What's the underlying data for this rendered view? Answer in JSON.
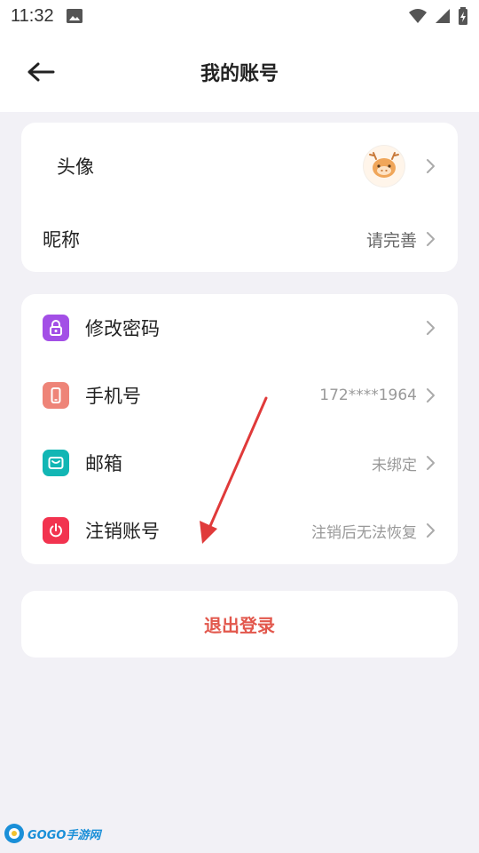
{
  "status_bar": {
    "time": "11:32"
  },
  "header": {
    "title": "我的账号"
  },
  "profile": {
    "avatar_label": "头像",
    "nickname_label": "昵称",
    "nickname_value": "请完善"
  },
  "security": {
    "items": [
      {
        "label": "修改密码",
        "value": "",
        "icon": "lock-icon",
        "color": "#a34fe6"
      },
      {
        "label": "手机号",
        "value": "172****1964",
        "icon": "phone-icon",
        "color": "#ee8478"
      },
      {
        "label": "邮箱",
        "value": "未绑定",
        "icon": "mail-icon",
        "color": "#12b6b4"
      },
      {
        "label": "注销账号",
        "value": "注销后无法恢复",
        "icon": "power-icon",
        "color": "#f2334f"
      }
    ]
  },
  "logout": {
    "label": "退出登录"
  },
  "watermark": {
    "text": "GOGO手游网"
  },
  "colors": {
    "accent": "#e2574c",
    "background": "#f2f1f6",
    "card": "#ffffff",
    "annotation_arrow": "#e03a3a"
  }
}
